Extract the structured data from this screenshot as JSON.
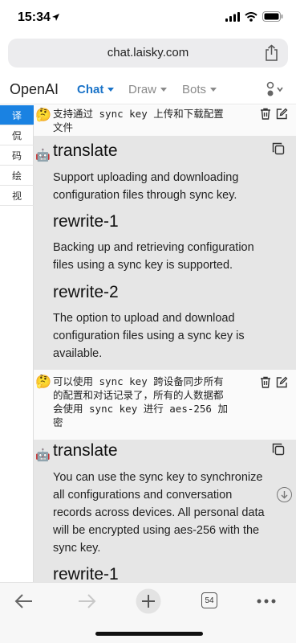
{
  "status_bar": {
    "time": "15:34"
  },
  "browser": {
    "url": "chat.laisky.com",
    "tab_count": "54"
  },
  "navbar": {
    "brand": "OpenAI",
    "items": [
      {
        "label": "Chat",
        "active": true
      },
      {
        "label": "Draw",
        "active": false
      },
      {
        "label": "Bots",
        "active": false
      }
    ]
  },
  "mode_menu": {
    "items": [
      {
        "label": "译",
        "active": true
      },
      {
        "label": "侃",
        "active": false
      },
      {
        "label": "码",
        "active": false
      },
      {
        "label": "绘",
        "active": false
      },
      {
        "label": "视",
        "active": false
      }
    ]
  },
  "messages": [
    {
      "role": "user",
      "emoji": "🤔",
      "lines": [
        "支持通过 sync key 上传和下载配置",
        "文件"
      ]
    },
    {
      "role": "assistant",
      "emoji": "🤖",
      "sections": [
        {
          "heading": "translate",
          "lines": [
            "Support uploading and downloading",
            "configuration files through sync key."
          ]
        },
        {
          "heading": "rewrite-1",
          "lines": [
            "Backing up and retrieving configuration",
            "files using a sync key is supported."
          ]
        },
        {
          "heading": "rewrite-2",
          "lines": [
            "The option to upload and download",
            "configuration files using a sync key is",
            "available."
          ]
        }
      ]
    },
    {
      "role": "user",
      "emoji": "🤔",
      "lines": [
        "可以使用 sync key 跨设备同步所有",
        "的配置和对话记录了，所有的人数据都",
        "会使用 sync key 进行 aes-256 加",
        "密"
      ]
    },
    {
      "role": "assistant",
      "emoji": "🤖",
      "sections": [
        {
          "heading": "translate",
          "lines": [
            "You can use the sync key to synchronize",
            "all configurations and conversation",
            "records across devices. All personal data",
            "will be encrypted using aes-256 with the",
            "sync key."
          ]
        },
        {
          "heading": "rewrite-1",
          "lines": []
        }
      ]
    }
  ],
  "colors": {
    "accent": "#1a82e2",
    "nav_active": "#1a73c8",
    "ai_bg": "#e6e6e6",
    "user_bg": "#fafafa"
  },
  "icons": {
    "share": "share-icon",
    "delete": "trash-icon",
    "edit": "edit-icon",
    "copy": "copy-icon",
    "scroll_down": "arrow-down-circle-icon",
    "back": "back-arrow-icon",
    "forward": "forward-arrow-icon",
    "new_tab": "plus-icon",
    "tabs": "tabs-icon",
    "more": "more-icon"
  }
}
